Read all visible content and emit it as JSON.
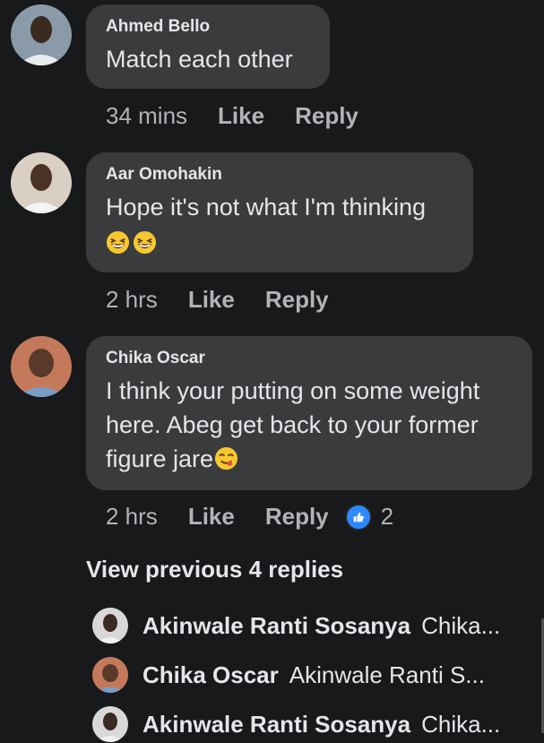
{
  "comments": [
    {
      "author": "Ahmed Bello",
      "text": "Match each other",
      "time": "34 mins",
      "like_label": "Like",
      "reply_label": "Reply"
    },
    {
      "author": "Aar Omohakin",
      "text": "Hope it's not what I'm thinking",
      "emojis": [
        "laughing-emoji",
        "laughing-emoji"
      ],
      "time": "2 hrs",
      "like_label": "Like",
      "reply_label": "Reply"
    },
    {
      "author": "Chika Oscar",
      "text_line1": "I think your putting on some weight",
      "text_line2": "here. Abeg get back to your former",
      "text_line3": "figure jare",
      "emoji": "savoring-food-emoji",
      "time": "2 hrs",
      "like_label": "Like",
      "reply_label": "Reply",
      "reaction_count": "2"
    }
  ],
  "view_previous": "View previous 4 replies",
  "replies": [
    {
      "name": "Akinwale Ranti Sosanya",
      "snippet": "Chika..."
    },
    {
      "name": "Chika Oscar",
      "snippet": "Akinwale Ranti S..."
    },
    {
      "name": "Akinwale Ranti Sosanya",
      "snippet": "Chika..."
    }
  ],
  "colors": {
    "background": "#18191a",
    "bubble": "#3a3b3c",
    "text": "#e4e6eb",
    "meta": "#b0b3b8",
    "like_badge": "#2e89ff"
  }
}
